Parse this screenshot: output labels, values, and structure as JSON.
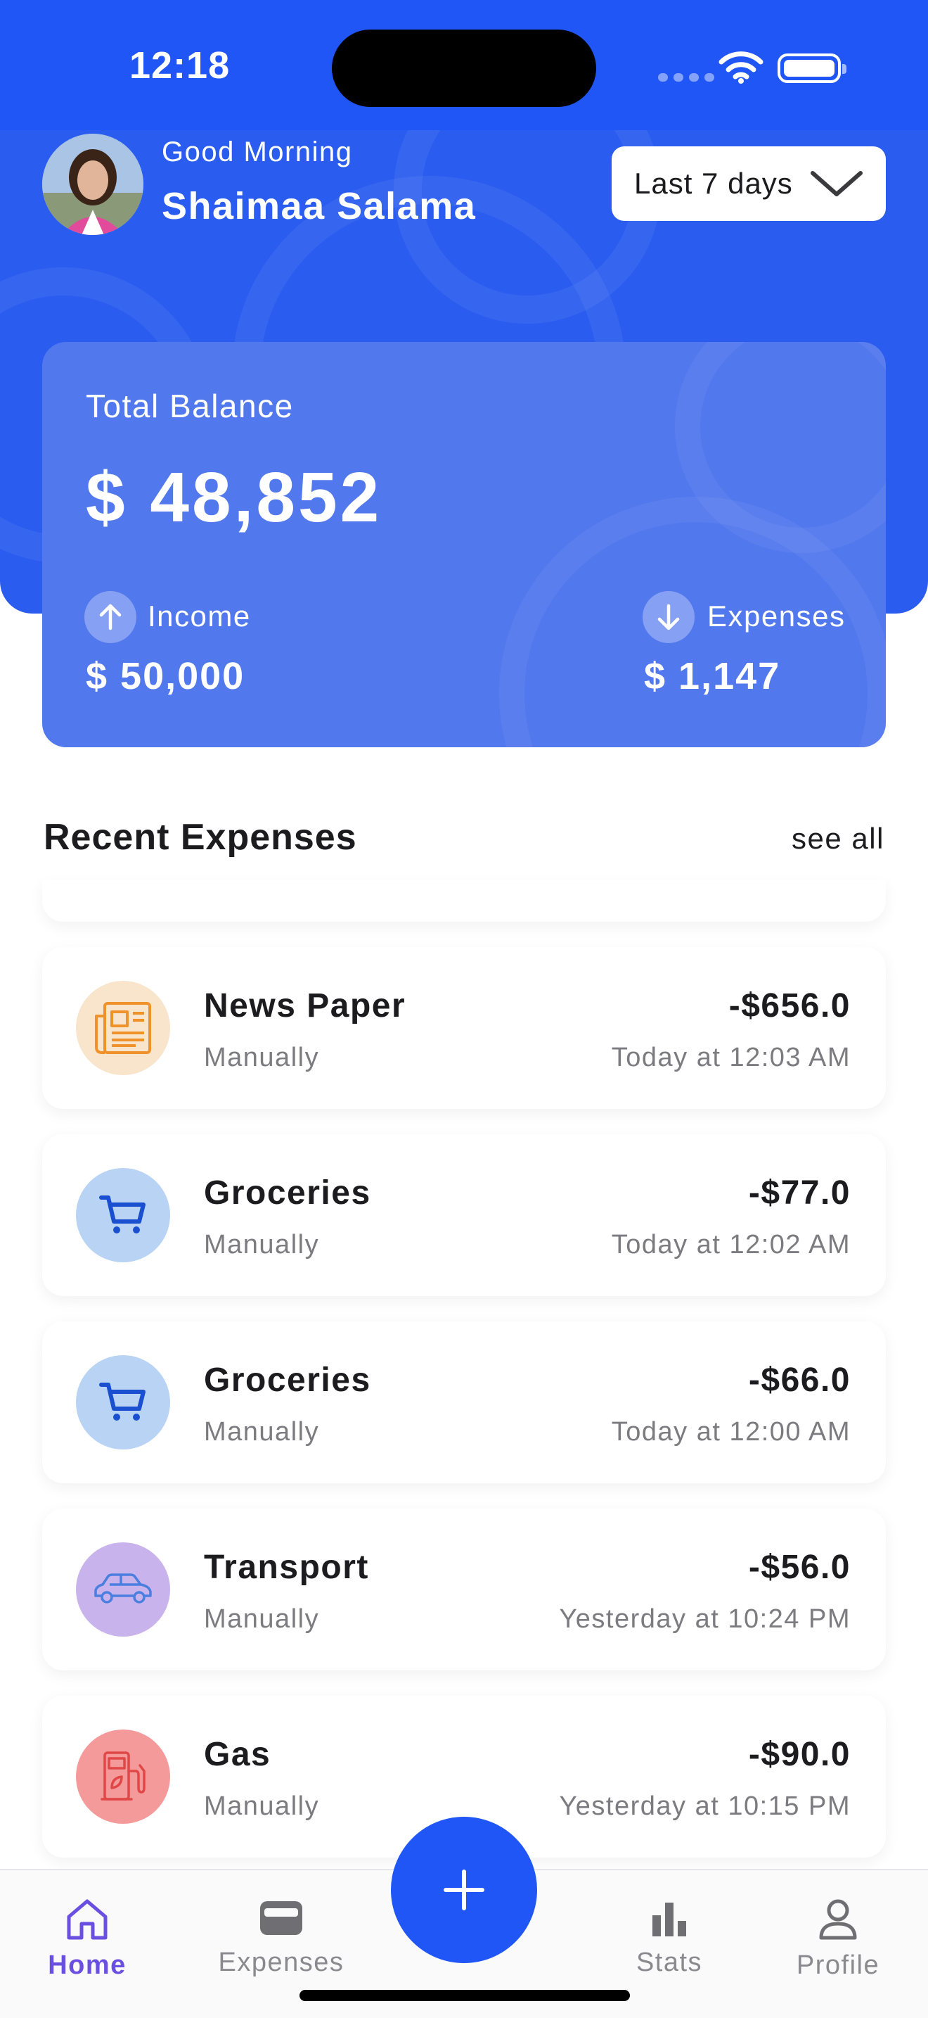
{
  "status_bar": {
    "time": "12:18"
  },
  "header": {
    "greeting": "Good Morning",
    "user_name": "Shaimaa Salama",
    "period_selector": {
      "selected": "Last 7 days"
    }
  },
  "balance": {
    "label": "Total Balance",
    "amount": "$ 48,852",
    "income": {
      "label": "Income",
      "amount": "$ 50,000"
    },
    "expenses": {
      "label": "Expenses",
      "amount": "$ 1,147"
    }
  },
  "recent_expenses": {
    "title": "Recent Expenses",
    "see_all": "see all",
    "items": [
      {
        "name": "News Paper",
        "source": "Manually",
        "amount": "-$656.0",
        "time": "Today at 12:03 AM",
        "icon": "newspaper-icon",
        "icon_bg": "#f9e4cc",
        "icon_color": "#f0922a"
      },
      {
        "name": "Groceries",
        "source": "Manually",
        "amount": "-$77.0",
        "time": "Today at 12:02 AM",
        "icon": "cart-icon",
        "icon_bg": "#b8d3f4",
        "icon_color": "#1a4fd0"
      },
      {
        "name": "Groceries",
        "source": "Manually",
        "amount": "-$66.0",
        "time": "Today at 12:00 AM",
        "icon": "cart-icon",
        "icon_bg": "#b8d3f4",
        "icon_color": "#1a4fd0"
      },
      {
        "name": "Transport",
        "source": "Manually",
        "amount": "-$56.0",
        "time": "Yesterday at 10:24 PM",
        "icon": "car-icon",
        "icon_bg": "#c9b3ec",
        "icon_color": "#4a7fe0"
      },
      {
        "name": "Gas",
        "source": "Manually",
        "amount": "-$90.0",
        "time": "Yesterday at 10:15 PM",
        "icon": "gas-pump-icon",
        "icon_bg": "#f59a9a",
        "icon_color": "#e04848"
      }
    ]
  },
  "tabbar": {
    "tabs": [
      {
        "label": "Home",
        "icon": "home-icon",
        "active": true
      },
      {
        "label": "Expenses",
        "icon": "wallet-icon",
        "active": false
      },
      {
        "label": "Stats",
        "icon": "bar-chart-icon",
        "active": false
      },
      {
        "label": "Profile",
        "icon": "person-icon",
        "active": false
      }
    ],
    "fab_icon": "plus-icon"
  },
  "colors": {
    "primary": "#1f56f5",
    "card": "#5278ee",
    "active_tab": "#6a4fe0"
  }
}
